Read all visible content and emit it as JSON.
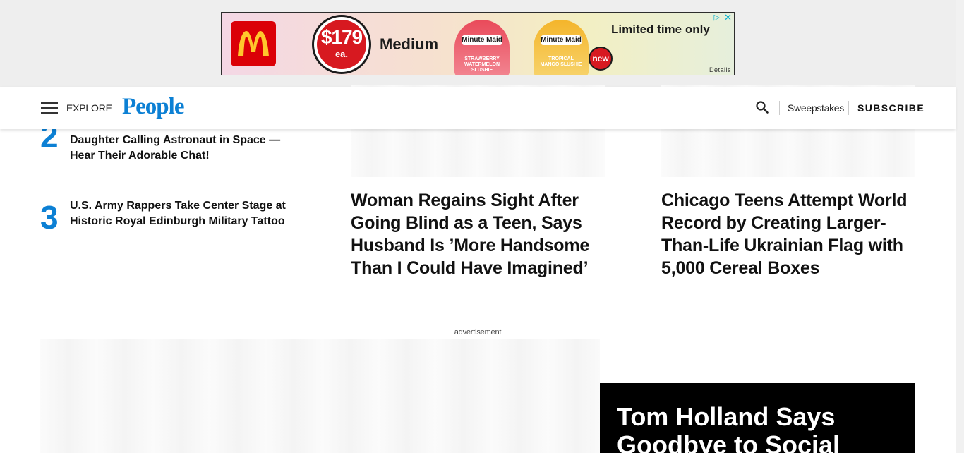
{
  "ad": {
    "price": "$179",
    "price_unit": "ea.",
    "size": "Medium",
    "cup1_brand": "Minute Maid",
    "cup1_flavor": "STRAWBERRY WATERMELON SLUSHIE",
    "cup2_brand": "Minute Maid",
    "cup2_flavor": "TROPICAL MANGO SLUSHIE",
    "new_badge": "new",
    "tagline": "Limited time only",
    "details": "Details",
    "brand_color": "#db0007"
  },
  "header": {
    "explore": "EXPLORE",
    "logo": "People",
    "sweepstakes": "Sweepstakes",
    "subscribe": "SUBSCRIBE",
    "logo_color": "#0c80d4"
  },
  "trending": [
    {
      "number": "2",
      "title": "Daughter Calling Astronaut in Space — Hear Their Adorable Chat!"
    },
    {
      "number": "3",
      "title": "U.S. Army Rappers Take Center Stage at Historic Royal Edinburgh Military Tattoo"
    }
  ],
  "stories": [
    {
      "title": "Woman Regains Sight After Going Blind as a Teen, Says Husband Is ’More Handsome Than I Could Have Imagined’"
    },
    {
      "title": "Chicago Teens Attempt World Record by Creating Larger-Than-Life Ukrainian Flag with 5,000 Cereal Boxes"
    }
  ],
  "advertisement_label": "advertisement",
  "feature": {
    "title": "Tom Holland Says Goodbye to Social"
  }
}
